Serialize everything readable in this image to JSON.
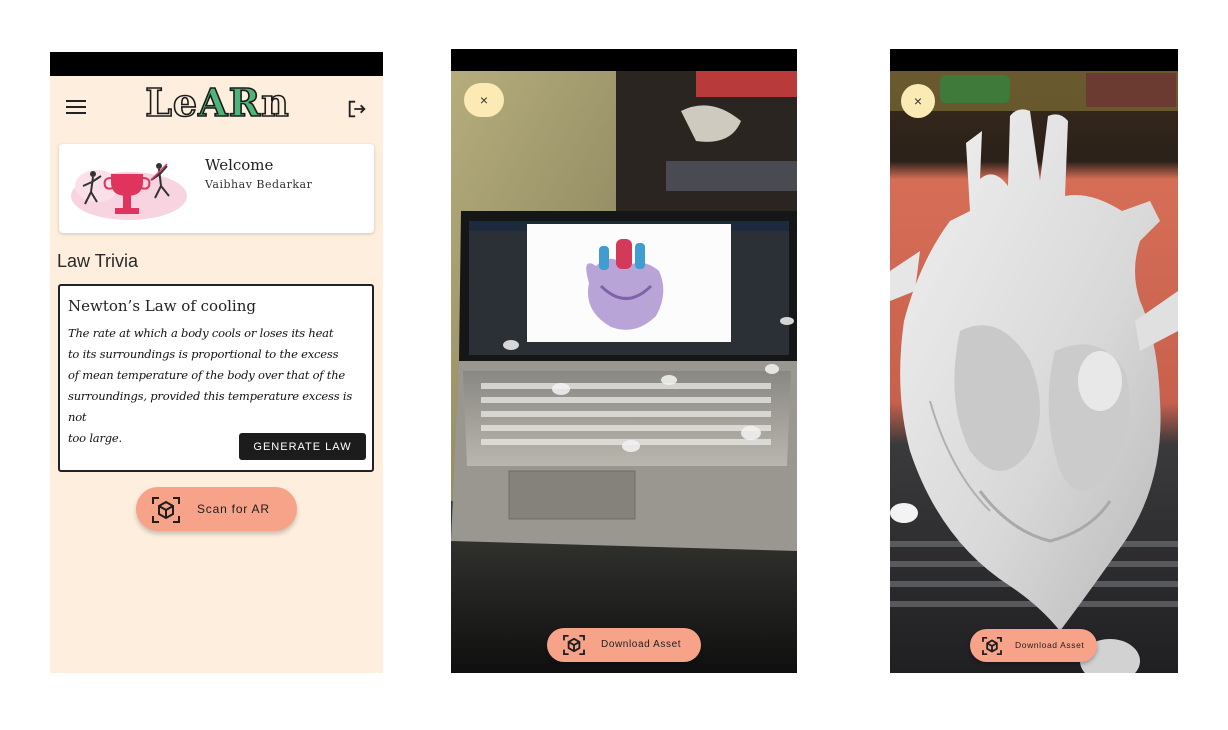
{
  "screen1": {
    "logo": {
      "part1": "Le",
      "part2": "AR",
      "part3": "n"
    },
    "welcome": {
      "title": "Welcome",
      "name": "Vaibhav Bedarkar"
    },
    "section_title": "Law Trivia",
    "law_card": {
      "title": "Newton’s Law of cooling",
      "lines": [
        "The rate at which a body cools or loses its heat",
        "to its surroundings is proportional to the excess",
        "of mean temperature of the body over that of the",
        "surroundings, provided this temperature excess is not",
        "too large."
      ],
      "button_label": "GENERATE LAW"
    },
    "scan_button_label": "Scan for AR",
    "icons": [
      "menu-icon",
      "logout-icon",
      "ar-cube-icon"
    ]
  },
  "screen2": {
    "close_symbol": "×",
    "download_label": "Download Asset"
  },
  "screen3": {
    "close_symbol": "×",
    "download_label": "Download Asset"
  },
  "colors": {
    "background": "#fdeedd",
    "accent": "#f7a38a",
    "close_button": "#fbeab3",
    "logo_ar": "#4fb37a",
    "dark_button": "#1c1c1c"
  }
}
